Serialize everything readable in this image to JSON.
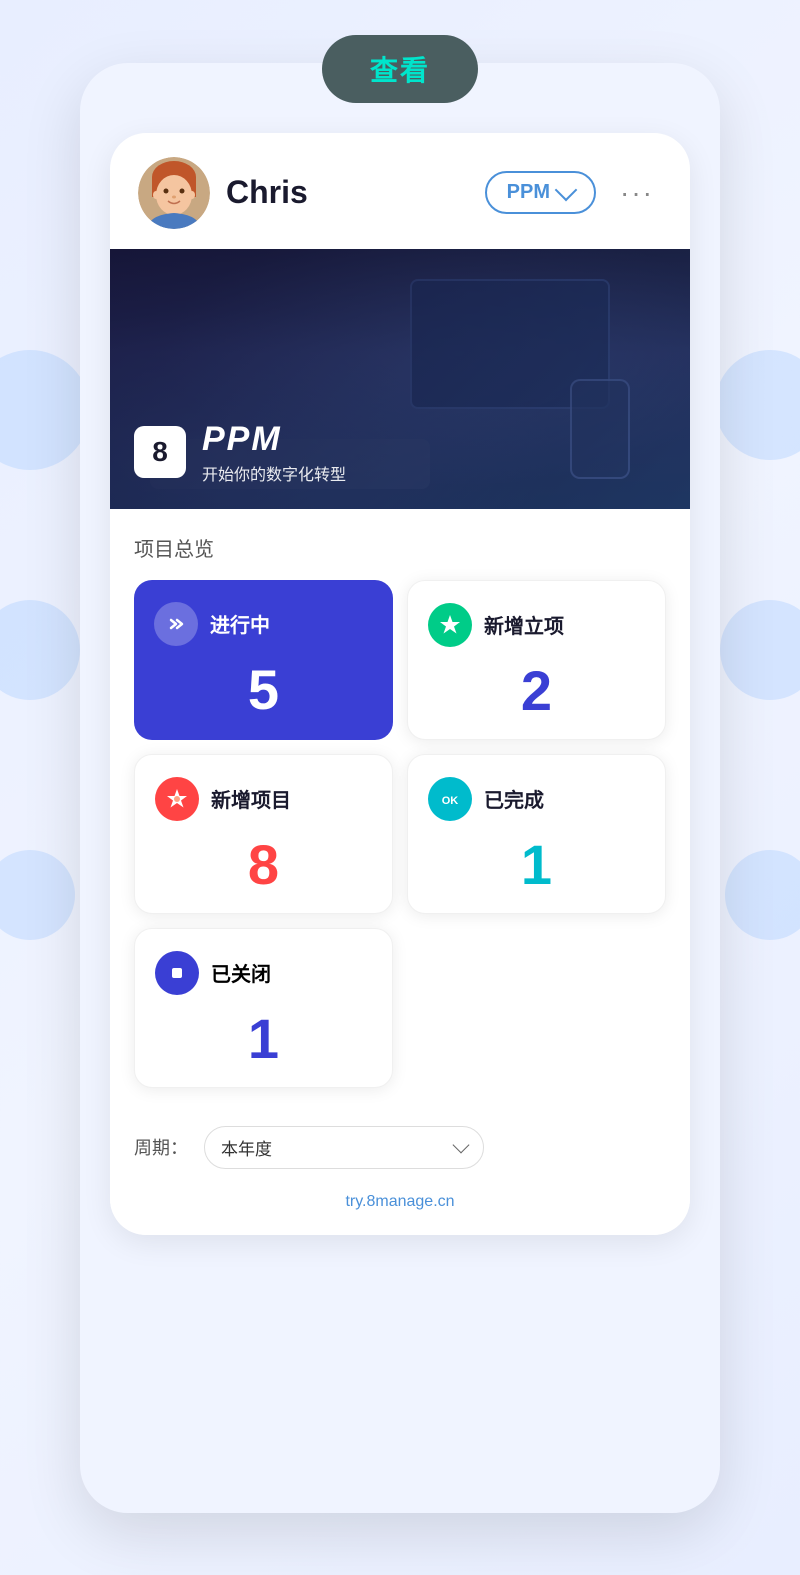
{
  "top_pill": {
    "label": "查看"
  },
  "header": {
    "user_name": "Chris",
    "dropdown_label": "PPM",
    "more_icon": "···"
  },
  "banner": {
    "brand_number": "8",
    "brand_name": "PPM",
    "tagline": "开始你的数字化转型"
  },
  "stats_section": {
    "title": "项目总览",
    "cards": [
      {
        "id": "in_progress",
        "label": "进行中",
        "value": "5",
        "icon_type": "arrows",
        "style": "active",
        "value_color": "val-white"
      },
      {
        "id": "new_projects",
        "label": "新增立项",
        "value": "2",
        "icon_type": "star",
        "style": "default",
        "value_color": "val-blue"
      },
      {
        "id": "added_items",
        "label": "新增项目",
        "value": "8",
        "icon_type": "star-orange",
        "style": "default",
        "value_color": "val-orange"
      },
      {
        "id": "completed",
        "label": "已完成",
        "value": "1",
        "icon_type": "ok",
        "style": "default",
        "value_color": "val-teal"
      }
    ],
    "closed_card": {
      "label": "已关闭",
      "value": "1",
      "icon_type": "square",
      "value_color": "val-blue2"
    }
  },
  "period": {
    "label": "周期：",
    "select_value": "本年度"
  },
  "footer": {
    "link": "try.8manage.cn"
  }
}
